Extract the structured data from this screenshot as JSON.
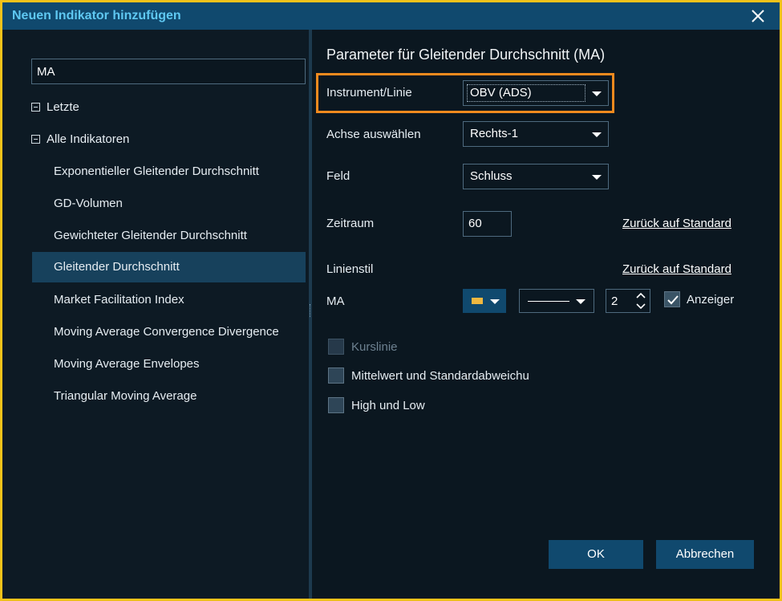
{
  "window": {
    "title": "Neuen Indikator hinzufügen"
  },
  "sidebar": {
    "search_value": "MA",
    "groups": [
      {
        "label": "Letzte"
      },
      {
        "label": "Alle Indikatoren"
      }
    ],
    "items": [
      {
        "label": "Exponentieller Gleitender Durchschnitt"
      },
      {
        "label": "GD-Volumen"
      },
      {
        "label": "Gewichteter Gleitender Durchschnitt"
      },
      {
        "label": "Gleitender Durchschnitt"
      },
      {
        "label": "Market Facilitation Index"
      },
      {
        "label": "Moving Average Convergence Divergence"
      },
      {
        "label": "Moving Average Envelopes"
      },
      {
        "label": "Triangular Moving Average"
      }
    ],
    "selected_index": 3
  },
  "params": {
    "title": "Parameter für Gleitender Durchschnitt (MA)",
    "instrument": {
      "label": "Instrument/Linie",
      "value": "OBV (ADS)"
    },
    "axis": {
      "label": "Achse auswählen",
      "value": "Rechts-1"
    },
    "field": {
      "label": "Feld",
      "value": "Schluss"
    },
    "period": {
      "label": "Zeitraum",
      "value": "60",
      "reset_link": "Zurück auf Standard"
    },
    "line_style": {
      "label": "Linienstil",
      "reset_link": "Zurück auf Standard"
    },
    "ma": {
      "label": "MA",
      "color": "#f0b840",
      "width_value": "2",
      "indicator_label": "Anzeiger",
      "indicator_checked": true
    },
    "options": [
      {
        "label": "Kurslinie",
        "checked": false,
        "disabled": true
      },
      {
        "label": "Mittelwert und Standardabweichu",
        "checked": false,
        "disabled": false
      },
      {
        "label": "High und Low",
        "checked": false,
        "disabled": false
      }
    ]
  },
  "footer": {
    "ok_label": "OK",
    "cancel_label": "Abbrechen"
  },
  "colors": {
    "accent": "#10496e",
    "title_text": "#5fc8f2",
    "highlight": "#f28a1e",
    "frame": "#f2c21a"
  }
}
